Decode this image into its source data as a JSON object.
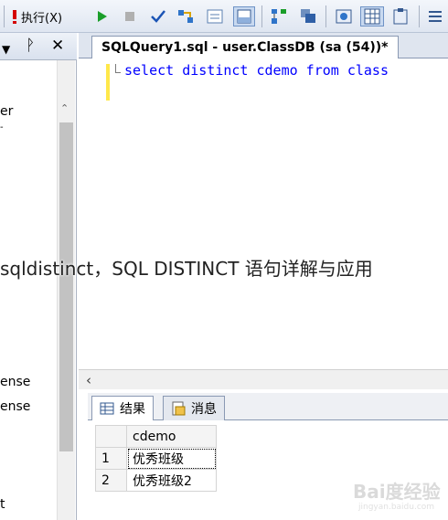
{
  "toolbar": {
    "execute_label": "执行(X)"
  },
  "left_panel": {
    "tree_items": [
      "er",
      "-",
      "ense",
      "ense",
      "t"
    ]
  },
  "editor": {
    "tab_title": "SQLQuery1.sql - user.ClassDB (sa (54))*",
    "code_line": "select distinct cdemo from class"
  },
  "results": {
    "tabs": [
      "结果",
      "消息"
    ],
    "columns": [
      "cdemo"
    ],
    "rows": [
      {
        "num": "1",
        "cdemo": "优秀班级"
      },
      {
        "num": "2",
        "cdemo": "优秀班级2"
      }
    ]
  },
  "overlay": {
    "title": "sqldistinct，SQL DISTINCT 语句详解与应用"
  },
  "watermark": {
    "text": "Bai度经验",
    "sub": "jingyan.baidu.com"
  },
  "colors": {
    "keyword": "#0000ff",
    "margin_marker": "#ffe84a",
    "toolbar_bg": "#dfe6f1"
  }
}
